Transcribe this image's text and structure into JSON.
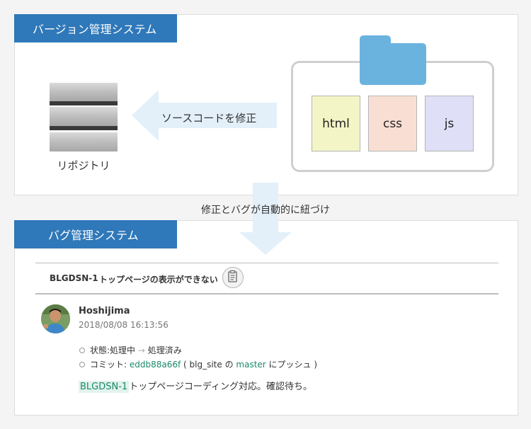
{
  "version_control": {
    "header": "バージョン管理システム",
    "repository_label": "リポジトリ",
    "arrow_label": "ソースコードを修正",
    "files": [
      "html",
      "css",
      "js"
    ]
  },
  "link_label": "修正とバグが自動的に紐づけ",
  "bug_tracking": {
    "header": "バグ管理システム",
    "issue_id": "BLGDSN-1",
    "issue_title": "トップページの表示ができない",
    "user_name": "Hoshijima",
    "timestamp": "2018/08/08 16:13:56",
    "status_prefix": "状態:処理中",
    "status_arrow": "→",
    "status_to": "処理済み",
    "commit_prefix": "コミット: ",
    "commit_hash": "eddb88a66f",
    "commit_mid": " ( blg_site の ",
    "commit_branch": "master",
    "commit_suffix": " にプッシュ )",
    "comment_issue_ref": "BLGDSN-1",
    "comment_text": "トップページコーディング対応。確認待ち。"
  },
  "colors": {
    "header_blue": "#2f78b9",
    "folder_blue": "#6bb3df",
    "arrow_light_blue": "#e3f0fa",
    "html_file": "#f3f5c6",
    "css_file": "#f9dfd3",
    "js_file": "#dfdff7",
    "commit_link": "#1a8a6b"
  },
  "icons": [
    "server-stack-icon",
    "folder-icon",
    "clipboard-icon",
    "avatar"
  ]
}
